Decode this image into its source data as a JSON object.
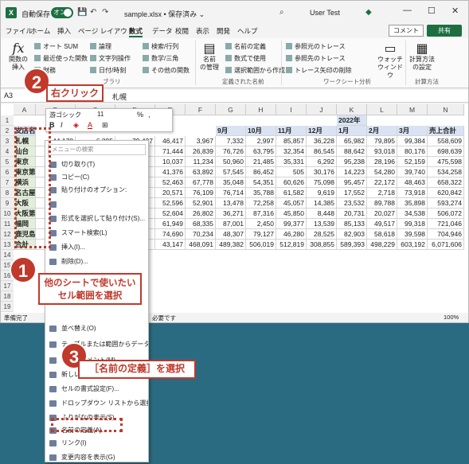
{
  "title_bar": {
    "autosave_label": "自動保存",
    "autosave_state": "オン",
    "doc_title": "sample.xlsx • 保存済み ⌄",
    "user": "User Test",
    "minimize": "—",
    "restore": "☐",
    "close": "✕"
  },
  "ribbon_tabs": [
    "ファイル",
    "ホーム",
    "挿入",
    "ページ レイアウト",
    "数式",
    "データ",
    "校閲",
    "表示",
    "開発",
    "ヘルプ"
  ],
  "ribbon_active_tab": "数式",
  "comment_label": "コメント",
  "share_label": "共有",
  "ribbon": {
    "insert_function": "関数の\n挿入",
    "autosum": "オート SUM",
    "recent": "最近使った関数",
    "financial": "財務",
    "logical": "論理",
    "text": "文字列操作",
    "datetime": "日付/時刻",
    "lookup": "検索/行列",
    "math": "数学/三角",
    "more": "その他の関数",
    "library_group": "ブラリ",
    "name_manager": "名前\nの管理",
    "define_name": "名前の定義",
    "use_in_formula": "数式で使用",
    "create_from_selection": "選択範囲から作成",
    "names_group": "定義された名前",
    "trace_precedents": "参照元のトレース",
    "trace_dependents": "参照先のトレース",
    "remove_arrows": "トレース矢印の削除",
    "auditing_group": "ワークシート分析",
    "watch": "ウォッチ\nウィンドウ",
    "calc_options": "計算方法\nの設定",
    "calc_group": "計算方法"
  },
  "formula_bar": {
    "namebox": "A3",
    "content": "札幌"
  },
  "columns": [
    "A",
    "B",
    "C",
    "D",
    "E",
    "F",
    "G",
    "H",
    "I",
    "J",
    "K",
    "L",
    "M",
    "N"
  ],
  "rows": [
    "1",
    "2",
    "3",
    "4",
    "5",
    "6",
    "7",
    "8",
    "9",
    "10",
    "11",
    "12",
    "13",
    "14",
    "15",
    "16",
    "17",
    "18",
    "19"
  ],
  "sheet": {
    "year_header": "2022年",
    "header_label": "支店名",
    "month_headers": [
      "9月",
      "10月",
      "11月",
      "12月",
      "1月",
      "2月",
      "3月"
    ],
    "total_header": "売上合計",
    "cities": [
      "札幌",
      "仙台",
      "東京",
      "東京第2",
      "横浜",
      "名古屋",
      "大阪",
      "大阪第2",
      "福岡",
      "鹿児島",
      "合計"
    ],
    "partial_b_c_d": [
      [
        "44,178",
        "6,395",
        "79,437"
      ],
      [
        "",
        "",
        ""
      ],
      [
        "",
        "",
        ""
      ],
      [
        "",
        "",
        ""
      ],
      [
        "",
        "",
        ""
      ],
      [
        "",
        "",
        ""
      ],
      [
        "",
        "",
        ""
      ],
      [
        "",
        "",
        ""
      ],
      [
        "",
        "",
        ""
      ],
      [
        "",
        "",
        ""
      ],
      [
        "",
        "",
        ""
      ]
    ],
    "col_e": [
      "46,417",
      "71,444",
      "10,037",
      "41,376",
      "52,463",
      "20,571",
      "52,596",
      "52,604",
      "61,949",
      "74,690",
      "43,147"
    ],
    "col_f": [
      "3,967",
      "26,839",
      "11,234",
      "63,892",
      "67,778",
      "76,109",
      "52,901",
      "26,802",
      "68,335",
      "70,234",
      "468,091"
    ],
    "col_g": [
      "7,332",
      "76,726",
      "50,960",
      "57,545",
      "35,048",
      "76,714",
      "13,478",
      "36,271",
      "87,001",
      "48,307",
      "489,382"
    ],
    "col_h": [
      "2,997",
      "63,795",
      "21,485",
      "86,452",
      "54,351",
      "35,788",
      "72,258",
      "87,316",
      "2,450",
      "79,127",
      "506,019"
    ],
    "col_i": [
      "85,857",
      "32,354",
      "35,331",
      "505",
      "60,626",
      "61,582",
      "45,057",
      "45,850",
      "99,377",
      "46,280",
      "512,819"
    ],
    "col_j": [
      "36,228",
      "86,545",
      "6,292",
      "30,176",
      "75,098",
      "9,619",
      "14,385",
      "8,448",
      "13,539",
      "28,525",
      "308,855"
    ],
    "col_k": [
      "65,982",
      "88,642",
      "95,238",
      "14,223",
      "95,457",
      "17,552",
      "23,532",
      "20,731",
      "85,133",
      "82,903",
      "589,393"
    ],
    "col_l": [
      "79,895",
      "93,018",
      "28,196",
      "54,280",
      "22,172",
      "2,718",
      "89,788",
      "20,027",
      "49,517",
      "58,618",
      "498,229"
    ],
    "col_m": [
      "99,384",
      "80,176",
      "52,159",
      "39,740",
      "48,463",
      "73,918",
      "35,898",
      "34,538",
      "99,318",
      "39,598",
      "603,192"
    ],
    "col_n": [
      "558,609",
      "698,639",
      "475,598",
      "534,258",
      "658,322",
      "620,842",
      "593,274",
      "506,072",
      "721,046",
      "704,946",
      "6,071,606"
    ]
  },
  "mini_toolbar": {
    "font": "游ゴシック",
    "size": "11",
    "percent": "%",
    "comma": ","
  },
  "context_menu": {
    "search": "メニューの検索",
    "items": [
      "切り取り(T)",
      "コピー(C)",
      "貼り付けのオプション:",
      "",
      "形式を選択して貼り付け(S)...",
      "スマート検索(L)",
      "挿入(I)...",
      "削除(D)..."
    ],
    "lower_items": [
      "並べ替え(O)",
      "テーブルまたは範囲からデータを...",
      "新しいコメント(M)",
      "新しいメモ(N)",
      "セルの書式設定(F)...",
      "ドロップダウン リストから選択(K)...",
      "ふりがなの表示(S)",
      "名前の定義(A)...",
      "リンク(I)",
      "変更内容を表示(G)"
    ]
  },
  "status": {
    "ready": "準備完了",
    "note": "必要です",
    "zoom": "100%"
  },
  "annotations": {
    "step1_badge": "1",
    "step1_text": "他のシートで使いたい\nセル範囲を選択",
    "step2_badge": "2",
    "step2_text": "右クリック",
    "step3_badge": "3",
    "step3_text": "［名前の定義］を選択"
  },
  "colors": {
    "accent": "#1d6f42",
    "callout": "#c0392b",
    "background": "#2b6b82"
  }
}
